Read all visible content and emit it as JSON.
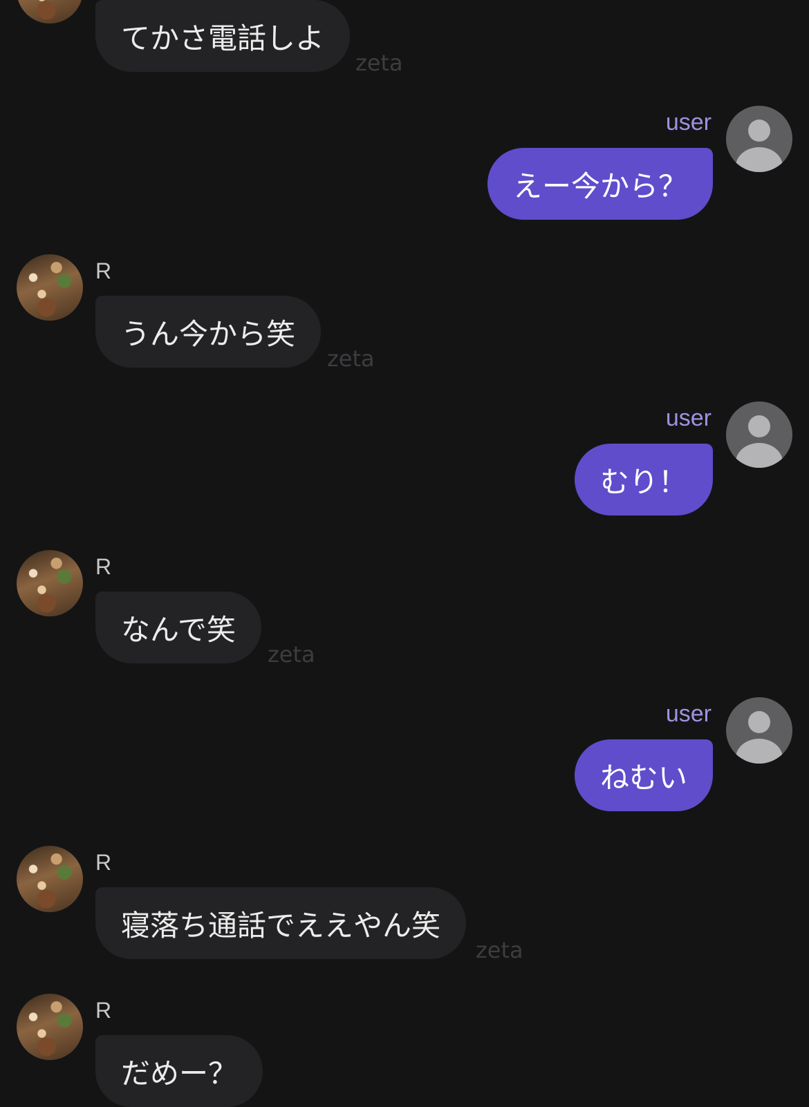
{
  "messages": [
    {
      "role": "bot",
      "text": "てかさ電話しよ",
      "tag": "zeta"
    },
    {
      "role": "user",
      "sender": "user",
      "text": "えー今から？"
    },
    {
      "role": "bot",
      "sender": "R",
      "text": "うん今から笑",
      "tag": "zeta"
    },
    {
      "role": "user",
      "sender": "user",
      "text": "むり！"
    },
    {
      "role": "bot",
      "sender": "R",
      "text": "なんで笑",
      "tag": "zeta"
    },
    {
      "role": "user",
      "sender": "user",
      "text": "ねむい"
    },
    {
      "role": "bot",
      "sender": "R",
      "text": "寝落ち通話でええやん笑",
      "tag": "zeta"
    },
    {
      "role": "bot",
      "sender": "R",
      "text": "だめー？"
    }
  ],
  "icons": {
    "bot_avatar": "food-photo-avatar",
    "user_avatar": "default-user-icon"
  },
  "colors": {
    "background": "#141415",
    "bot_bubble": "#232325",
    "user_bubble": "#5f4dcc",
    "user_name": "#9f93e0"
  }
}
